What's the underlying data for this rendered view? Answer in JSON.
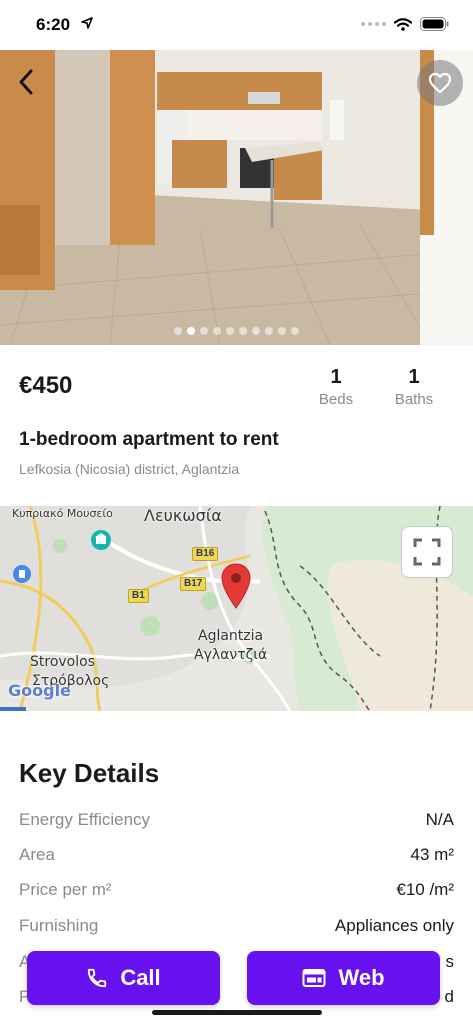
{
  "status_bar": {
    "time": "6:20"
  },
  "listing": {
    "price": "€450",
    "beds_count": "1",
    "beds_label": "Beds",
    "baths_count": "1",
    "baths_label": "Baths",
    "title": "1-bedroom apartment to rent",
    "location": "Lefkosia (Nicosia) district, Aglantzia",
    "photo_count": 10,
    "active_photo_index": 1
  },
  "map": {
    "labels": {
      "museum": "Κυπριακό Μουσείο",
      "city": "Λευκωσία",
      "aglantzia": "Aglantzia",
      "aglantzia_gr": "Αγλαντζιά",
      "strovolos": "Strovolos",
      "strovolos_gr": "Στρόβολος",
      "google": "Google"
    },
    "roads": {
      "b16": "B16",
      "b17": "B17",
      "b1": "B1"
    }
  },
  "key_details": {
    "heading": "Key Details",
    "rows": [
      {
        "label": "Energy Efficiency",
        "value": "N/A"
      },
      {
        "label": "Area",
        "value": "43 m²"
      },
      {
        "label": "Price per m²",
        "value": "€10 /m²"
      },
      {
        "label": "Furnishing",
        "value": "Appliances only"
      },
      {
        "label": "A",
        "value": "s"
      },
      {
        "label": "P",
        "value": "d"
      }
    ]
  },
  "actions": {
    "call_label": "Call",
    "web_label": "Web"
  },
  "colors": {
    "accent": "#6611ee",
    "pin": "#e53935"
  },
  "icons": [
    "location-arrow-icon",
    "wifi-icon",
    "battery-icon",
    "back-chevron-icon",
    "heart-icon",
    "fullscreen-icon",
    "phone-icon",
    "web-icon",
    "map-pin-icon",
    "museum-icon"
  ]
}
